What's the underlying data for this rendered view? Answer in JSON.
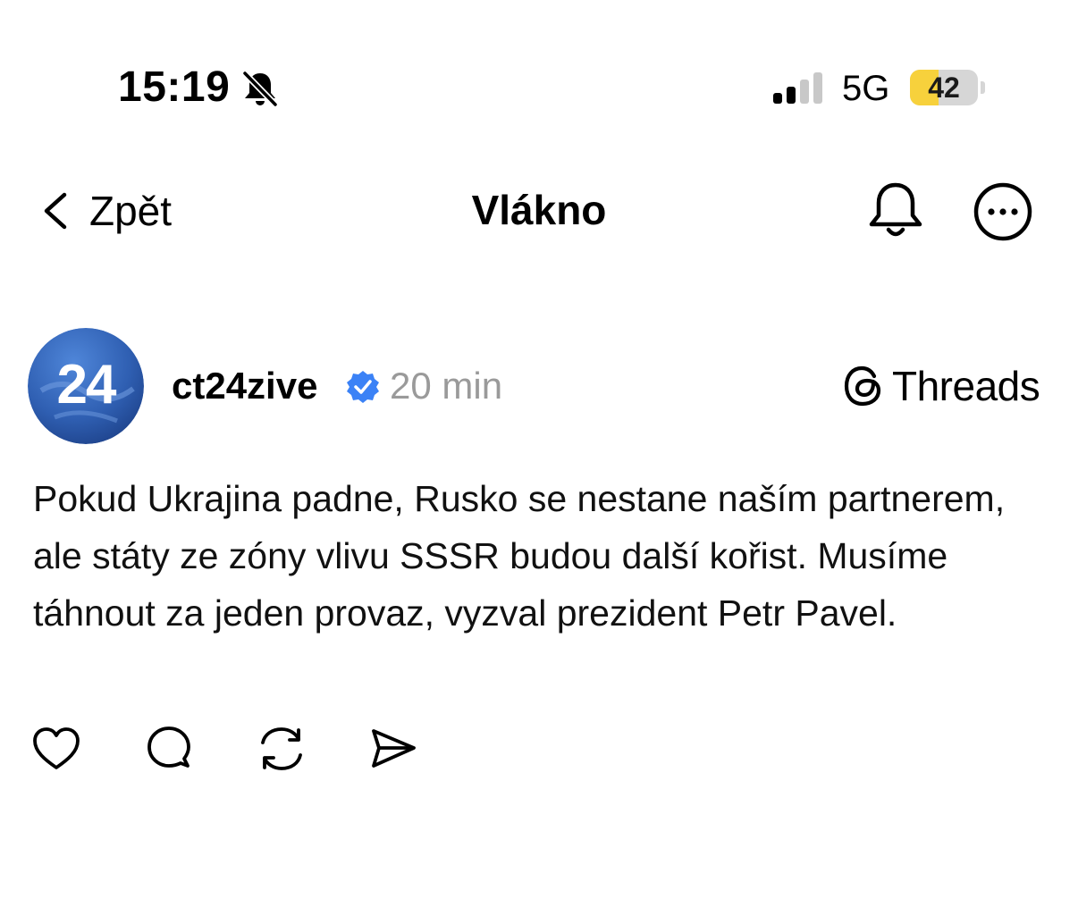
{
  "status_bar": {
    "time": "15:19",
    "mute_icon": "bell-slash-icon",
    "network": "5G",
    "battery_level": "42",
    "battery_fraction": 0.42,
    "battery_color": "#f7d13c"
  },
  "nav": {
    "back_icon": "chevron-left-icon",
    "back_label": "Zpět",
    "title": "Vlákno",
    "notifications_icon": "bell-icon",
    "more_icon": "more-horizontal-icon"
  },
  "post": {
    "avatar_text": "24",
    "avatar_color": "#2f5fb2",
    "username": "ct24zive",
    "verified_icon": "verified-badge-icon",
    "verified_color": "#3b82f6",
    "time": "20 min",
    "platform_icon": "threads-logo-icon",
    "platform": "Threads",
    "text": "Pokud Ukrajina padne, Rusko se nestane naším partnerem, ale státy ze zóny vlivu SSSR budou další kořist. Musíme táhnout za jeden provaz, vyzval prezident Petr Pavel.",
    "actions": [
      "heart-icon",
      "comment-icon",
      "repost-icon",
      "share-icon"
    ]
  }
}
